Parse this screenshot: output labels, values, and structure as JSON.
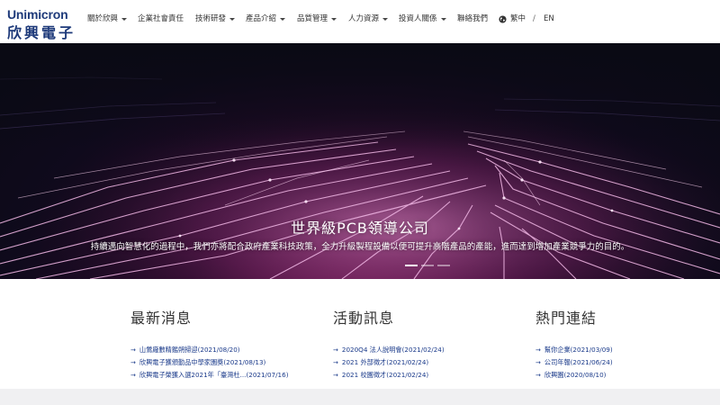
{
  "logo": {
    "en": "Unimicron",
    "zh": "欣興電子"
  },
  "nav": {
    "items": [
      {
        "label": "關於欣興",
        "caret": true
      },
      {
        "label": "企業社會責任",
        "caret": false
      },
      {
        "label": "技術研發",
        "caret": true
      },
      {
        "label": "產品介紹",
        "caret": true
      },
      {
        "label": "品質管理",
        "caret": true
      },
      {
        "label": "人力資源",
        "caret": true
      },
      {
        "label": "投資人關係",
        "caret": true
      },
      {
        "label": "聯絡我們",
        "caret": false
      }
    ],
    "lang_zh": "繁中",
    "lang_sep": "/",
    "lang_en": "EN"
  },
  "hero": {
    "title": "世界級PCB領導公司",
    "subtitle": "持續邁向智慧化的過程中，我們亦將配合政府產業科技政策，全力升級製程設備以便可提升高階產品的產能，進而達到增加產業競爭力的目的。",
    "slides": 3,
    "active_slide": 0
  },
  "sections": [
    {
      "title": "最新消息",
      "items": [
        "山鶯廠數精鑑朔掃迎(2021/08/20)",
        "欣興電子獲頒勤品中學家園獎(2021/08/13)",
        "欣興電子榮獲入選2021年「臺灣杜...(2021/07/16)"
      ]
    },
    {
      "title": "活動訊息",
      "items": [
        "2020Q4 法人說明會(2021/02/24)",
        "2021 外部徵才(2021/02/24)",
        "2021 校園徵才(2021/02/24)"
      ]
    },
    {
      "title": "熱門連結",
      "items": [
        "幫你企業(2021/03/09)",
        "公司年報(2021/06/24)",
        "欣興園(2020/08/10)"
      ]
    }
  ],
  "colors": {
    "brand": "#1e3a7a",
    "link": "#1a3a8a",
    "circuit": "#e8a0d8"
  }
}
